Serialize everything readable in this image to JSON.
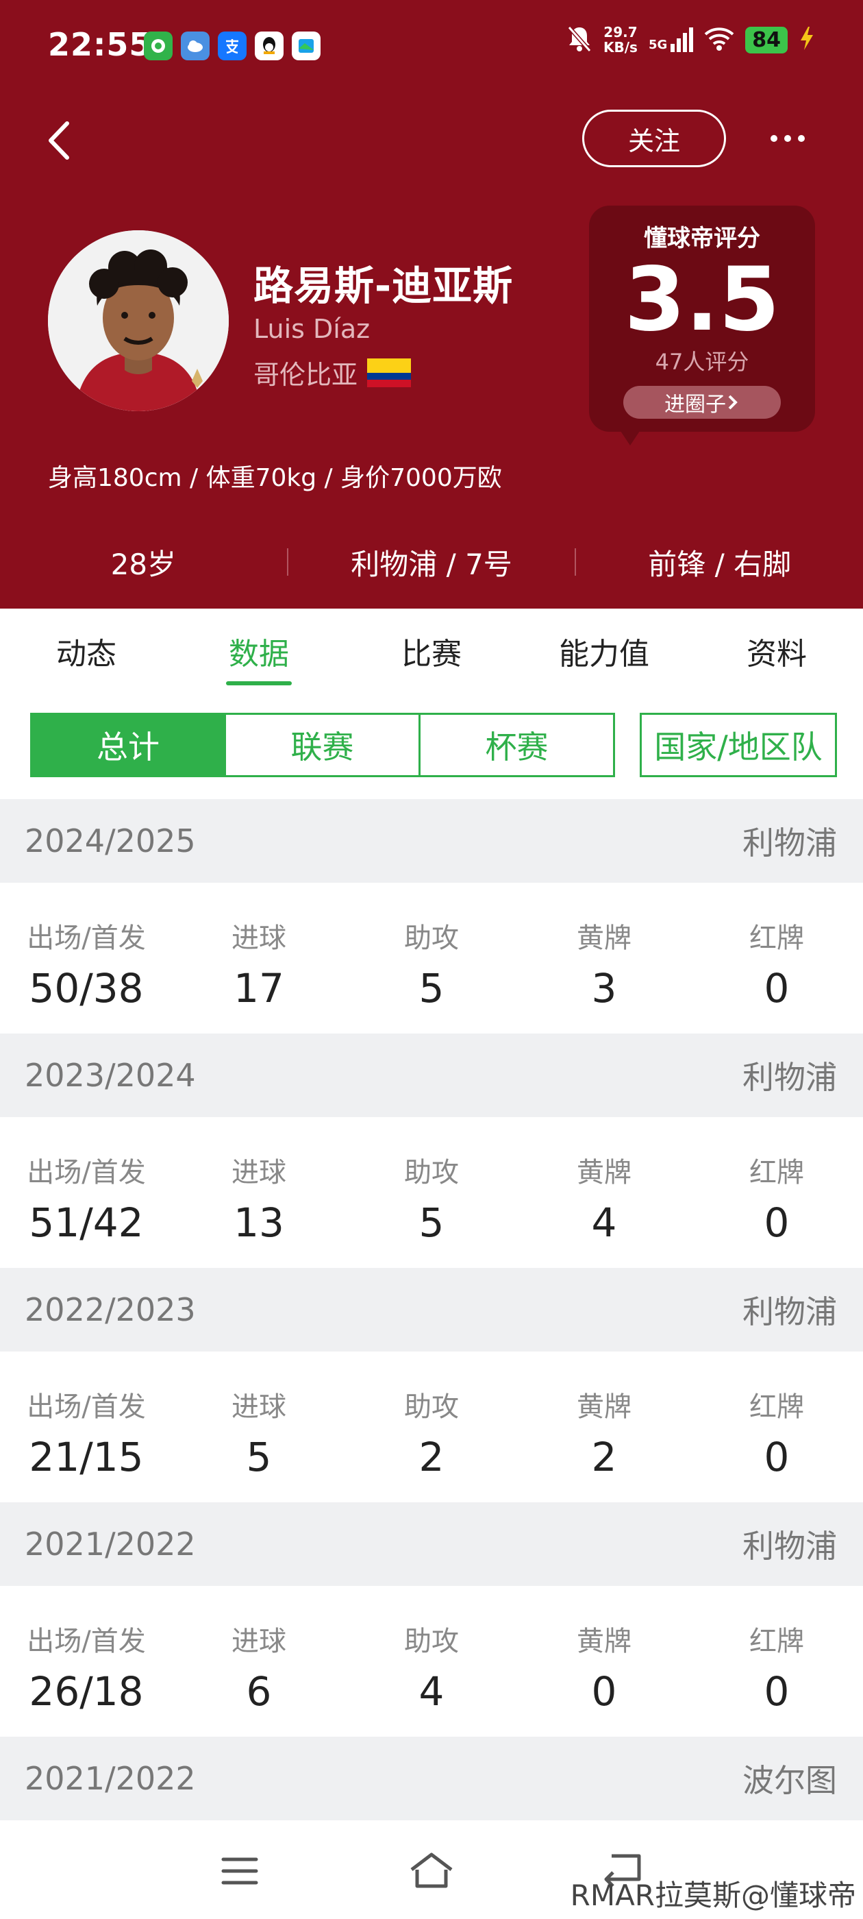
{
  "status": {
    "time": "22:55",
    "net_speed_value": "29.7",
    "net_speed_unit": "KB/s",
    "signal": "5G",
    "battery": "84"
  },
  "header": {
    "follow_label": "关注",
    "player_name_cn": "路易斯-迪亚斯",
    "player_name_en": "Luis Díaz",
    "country": "哥伦比亚",
    "flag_colors": [
      "#fcd116",
      "#003893",
      "#ce1126"
    ],
    "rating": {
      "title": "懂球帝评分",
      "score": "3.5",
      "count": "47人评分",
      "circle_label": "进圈子"
    },
    "body_info": "身高180cm / 体重70kg / 身价7000万欧",
    "age": "28岁",
    "club_number": "利物浦 / 7号",
    "position_foot": "前锋 / 右脚"
  },
  "tabs": [
    {
      "label": "动态",
      "active": false
    },
    {
      "label": "数据",
      "active": true
    },
    {
      "label": "比赛",
      "active": false
    },
    {
      "label": "能力值",
      "active": false
    },
    {
      "label": "资料",
      "active": false
    }
  ],
  "filters": [
    {
      "label": "总计",
      "active": true
    },
    {
      "label": "联赛",
      "active": false
    },
    {
      "label": "杯赛",
      "active": false
    },
    {
      "label": "国家/地区队",
      "active": false
    }
  ],
  "stat_labels": {
    "apps": "出场/首发",
    "goals": "进球",
    "assists": "助攻",
    "yellow": "黄牌",
    "red": "红牌"
  },
  "seasons": [
    {
      "season": "2024/2025",
      "team": "利物浦",
      "apps": "50/38",
      "goals": "17",
      "assists": "5",
      "yellow": "3",
      "red": "0"
    },
    {
      "season": "2023/2024",
      "team": "利物浦",
      "apps": "51/42",
      "goals": "13",
      "assists": "5",
      "yellow": "4",
      "red": "0"
    },
    {
      "season": "2022/2023",
      "team": "利物浦",
      "apps": "21/15",
      "goals": "5",
      "assists": "2",
      "yellow": "2",
      "red": "0"
    },
    {
      "season": "2021/2022",
      "team": "利物浦",
      "apps": "26/18",
      "goals": "6",
      "assists": "4",
      "yellow": "0",
      "red": "0"
    },
    {
      "season": "2021/2022",
      "team": "波尔图"
    }
  ],
  "watermark": "RMAR拉莫斯@懂球帝",
  "colors": {
    "header_bg": "#8a0e1c",
    "accent_green": "#2fb04a"
  }
}
